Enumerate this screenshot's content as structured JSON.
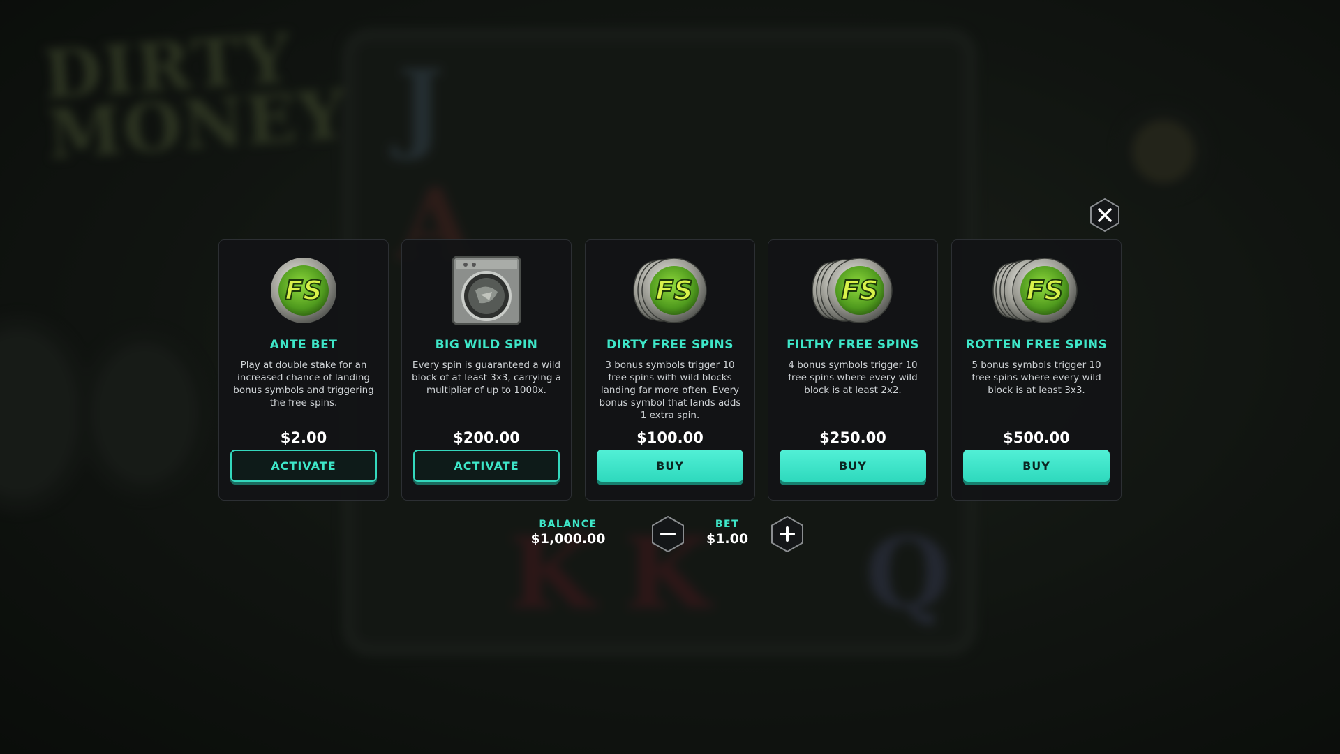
{
  "background": {
    "logo_lines": [
      "DIRTY",
      "MONEY"
    ],
    "reel_symbols": [
      "J",
      "A",
      "K",
      "K",
      "Q"
    ]
  },
  "cards": [
    {
      "title": "ANTE BET",
      "description": "Play at double stake for an increased chance of landing bonus symbols and triggering the free spins.",
      "price": "$2.00",
      "button": "ACTIVATE",
      "icon": "fs-coin-icon",
      "icon_text": "FS"
    },
    {
      "title": "BIG WILD SPIN",
      "description": "Every spin is guaranteed a wild block of at least 3x3, carrying a multiplier of up to 1000x.",
      "price": "$200.00",
      "button": "ACTIVATE",
      "icon": "washing-machine-icon"
    },
    {
      "title": "DIRTY FREE SPINS",
      "description": "3 bonus symbols trigger 10 free spins with wild blocks landing far more often. Every bonus symbol that lands adds 1 extra spin.",
      "price": "$100.00",
      "button": "BUY",
      "icon": "fs-coin-stack-3-icon",
      "icon_text": "FS"
    },
    {
      "title": "FILTHY FREE SPINS",
      "description": "4 bonus symbols trigger 10 free spins where every wild block is at least 2x2.",
      "price": "$250.00",
      "button": "BUY",
      "icon": "fs-coin-stack-4-icon",
      "icon_text": "FS"
    },
    {
      "title": "ROTTEN FREE SPINS",
      "description": "5 bonus symbols trigger 10 free spins where every wild block is at least 3x3.",
      "price": "$500.00",
      "button": "BUY",
      "icon": "fs-coin-stack-5-icon",
      "icon_text": "FS"
    }
  ],
  "balance": {
    "label": "BALANCE",
    "value": "$1,000.00"
  },
  "bet": {
    "label": "BET",
    "value": "$1.00"
  },
  "colors": {
    "accent": "#3ee6c8",
    "button_fill": "#34d8bd",
    "card_bg": "#121416",
    "coin_green": "#6fc22a"
  },
  "icons": {
    "close": "close-icon",
    "decrease": "minus-icon",
    "increase": "plus-icon"
  }
}
